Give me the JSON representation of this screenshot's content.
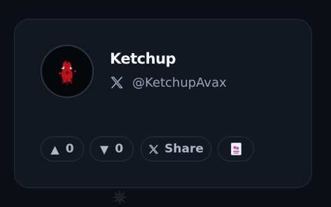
{
  "profile": {
    "name": "Ketchup",
    "handle": "@KetchupAvax",
    "avatar_icon": "red-ketchup-creature-avatar",
    "social_icon": "x-logo-icon"
  },
  "actions": {
    "upvote_symbol": "▲",
    "upvote_count": "0",
    "downvote_symbol": "▼",
    "downvote_count": "0",
    "share_label": "Share",
    "nft_icon": "card-thumbnail-icon"
  },
  "colors": {
    "background": "#0b0e14",
    "card": "#121822",
    "border": "#252d3a",
    "name": "#f3f5f8",
    "muted": "#9aa3b4",
    "accent_red": "#c0141b"
  },
  "footer_icon": "gear-icon"
}
